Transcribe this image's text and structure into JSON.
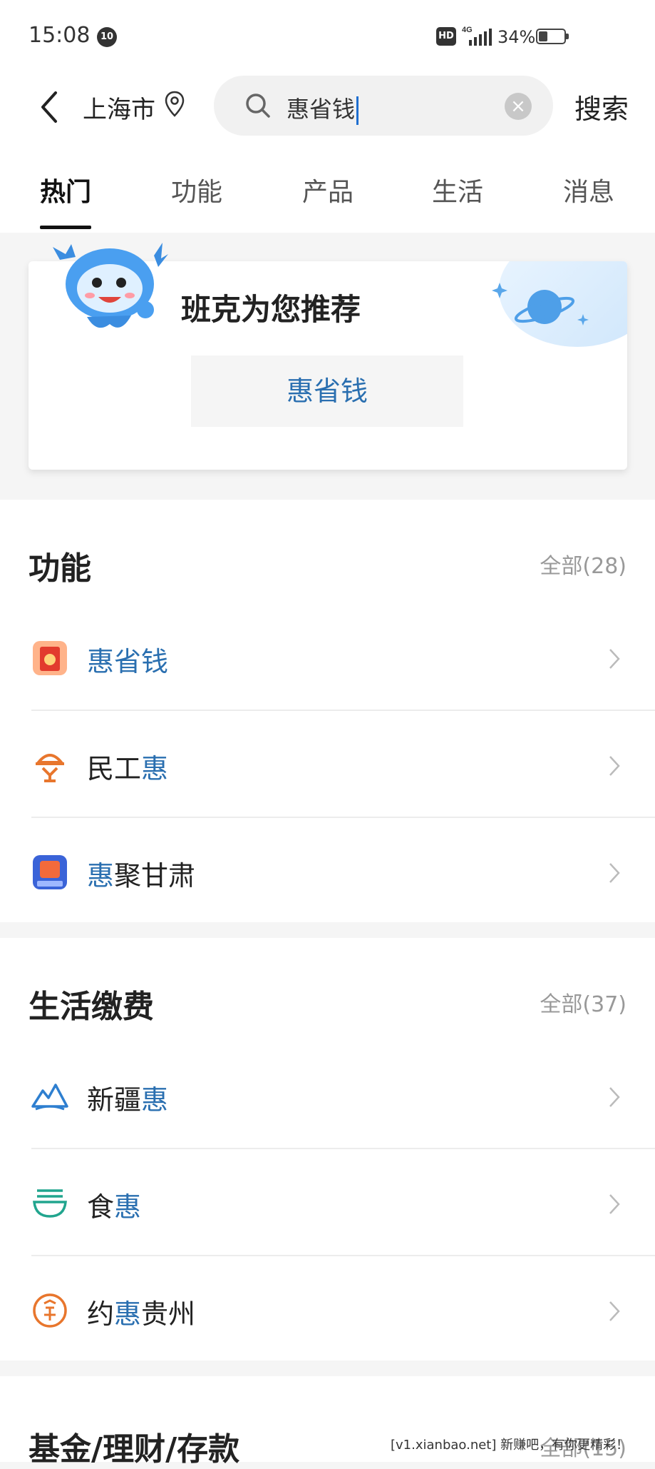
{
  "status_bar": {
    "time": "15:08",
    "notif_count": "10",
    "hd": "HD",
    "network": "4G",
    "battery": "34%"
  },
  "header": {
    "city": "上海市",
    "search_value": "惠省钱",
    "search_button": "搜索"
  },
  "tabs": [
    {
      "label": "热门"
    },
    {
      "label": "功能"
    },
    {
      "label": "产品"
    },
    {
      "label": "生活"
    },
    {
      "label": "消息"
    }
  ],
  "recommend": {
    "title": "班克为您推荐",
    "chip": "惠省钱"
  },
  "functions": {
    "title": "功能",
    "all": "全部(28)",
    "items": [
      {
        "pre": "",
        "hl": "惠省钱",
        "post": "",
        "icon": "red-packet-icon"
      },
      {
        "pre": "民工",
        "hl": "惠",
        "post": "",
        "icon": "worker-helmet-icon"
      },
      {
        "pre": "",
        "hl": "惠",
        "post": "聚甘肃",
        "icon": "gansu-app-icon"
      }
    ]
  },
  "life": {
    "title": "生活缴费",
    "all": "全部(37)",
    "items": [
      {
        "pre": "新疆",
        "hl": "惠",
        "post": "",
        "icon": "mountain-icon"
      },
      {
        "pre": "食",
        "hl": "惠",
        "post": "",
        "icon": "bowl-icon"
      },
      {
        "pre": "约",
        "hl": "惠",
        "post": "贵州",
        "icon": "guizhou-seal-icon"
      }
    ]
  },
  "funds": {
    "title": "基金/理财/存款",
    "all": "全部(15)"
  },
  "watermark": "[v1.xianbao.net] 新赚吧，有你更精彩！",
  "colors": {
    "highlight": "#2a6fb0",
    "tab_active": "#111111"
  }
}
